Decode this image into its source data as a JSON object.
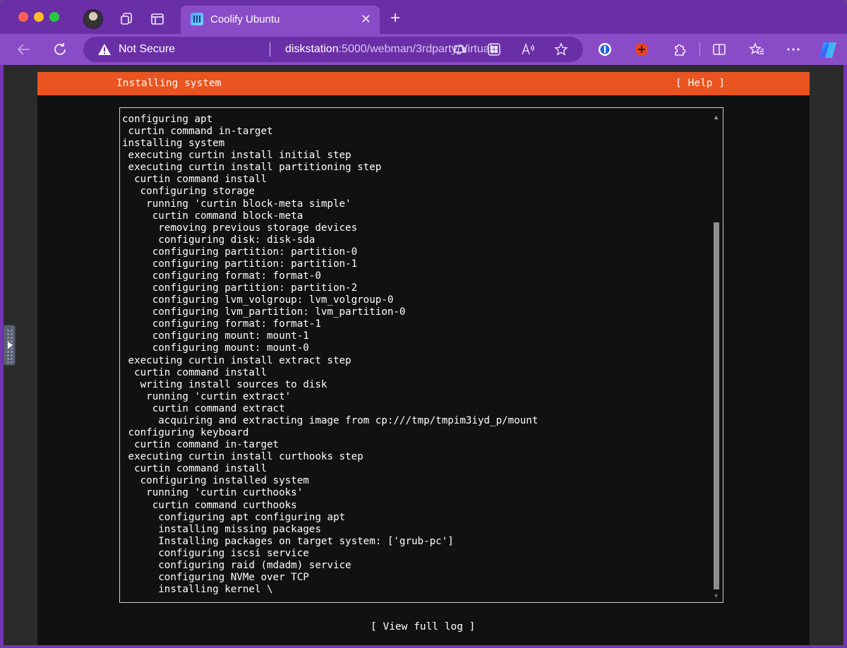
{
  "browser": {
    "tab": {
      "title": "Coolify Ubuntu"
    },
    "address": {
      "security_label": "Not Secure",
      "url_host": "diskstation",
      "url_rest": ":5000/webman/3rdparty/Virtual..."
    }
  },
  "installer": {
    "header_title": "Installing system",
    "help_label": "[ Help ]",
    "log_lines": [
      "configuring apt",
      " curtin command in-target",
      "installing system",
      " executing curtin install initial step",
      " executing curtin install partitioning step",
      "  curtin command install",
      "   configuring storage",
      "    running 'curtin block-meta simple'",
      "     curtin command block-meta",
      "      removing previous storage devices",
      "      configuring disk: disk-sda",
      "     configuring partition: partition-0",
      "     configuring partition: partition-1",
      "     configuring format: format-0",
      "     configuring partition: partition-2",
      "     configuring lvm_volgroup: lvm_volgroup-0",
      "     configuring lvm_partition: lvm_partition-0",
      "     configuring format: format-1",
      "     configuring mount: mount-1",
      "     configuring mount: mount-0",
      " executing curtin install extract step",
      "  curtin command install",
      "   writing install sources to disk",
      "    running 'curtin extract'",
      "     curtin command extract",
      "      acquiring and extracting image from cp:///tmp/tmpim3iyd_p/mount",
      " configuring keyboard",
      "  curtin command in-target",
      " executing curtin install curthooks step",
      "  curtin command install",
      "   configuring installed system",
      "    running 'curtin curthooks'",
      "     curtin command curthooks",
      "      configuring apt configuring apt",
      "      installing missing packages",
      "      Installing packages on target system: ['grub-pc']",
      "      configuring iscsi service",
      "      configuring raid (mdadm) service",
      "      configuring NVMe over TCP",
      "      installing kernel \\"
    ],
    "view_log_label": "[ View full log ]"
  },
  "colors": {
    "header_accent": "#e95420",
    "browser_frame": "#8a4cc6",
    "terminal_bg": "#111111"
  },
  "icons": {
    "tabbar": [
      "avatar",
      "collections-icon",
      "tab-actions-icon",
      "new-tab-icon"
    ],
    "toolbar": [
      "back-icon",
      "refresh-icon",
      "warning-icon",
      "app-available-icon",
      "apps-icon",
      "read-aloud-icon",
      "favorite-star-icon",
      "password-manager-icon",
      "extension-plus-icon",
      "extensions-icon",
      "split-screen-icon",
      "favorites-icon",
      "more-icon",
      "copilot-icon"
    ]
  }
}
